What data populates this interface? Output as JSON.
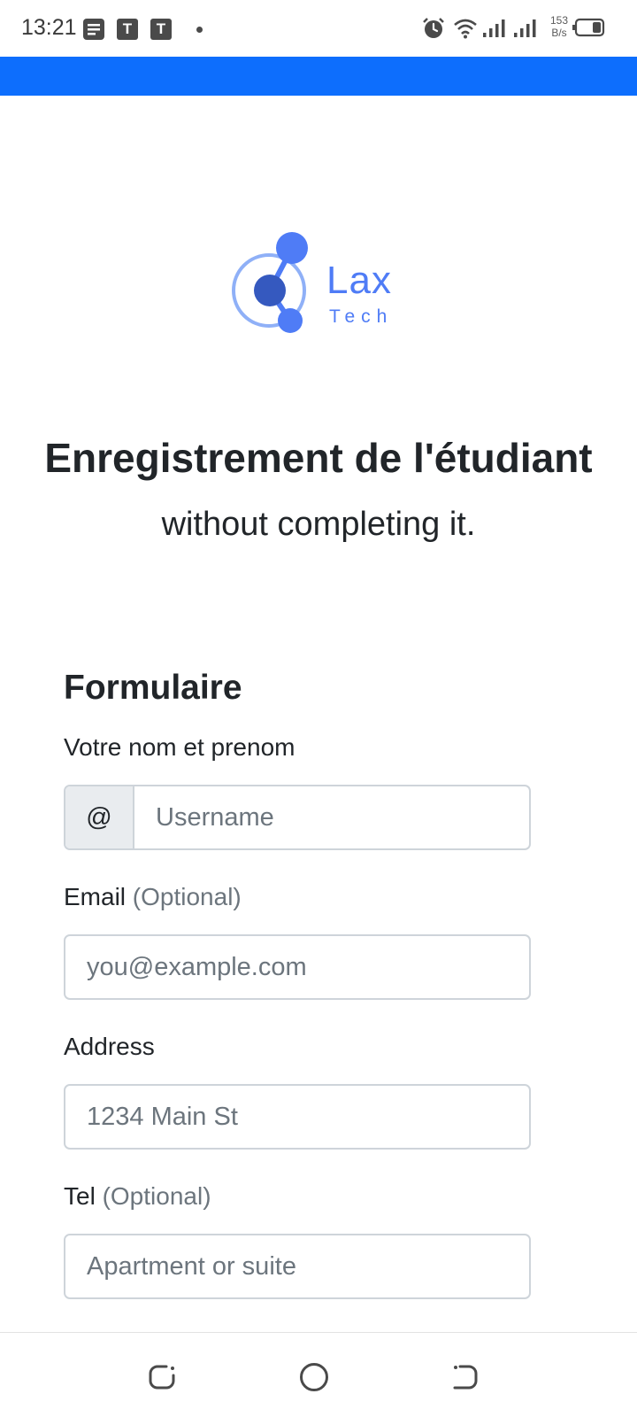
{
  "status_bar": {
    "time": "13:21",
    "notif_icons": [
      "notes-icon",
      "t-app-icon",
      "t-app-icon"
    ],
    "notif_letters": [
      "T",
      "T"
    ],
    "net_speed_value": "153",
    "net_speed_unit": "B/s"
  },
  "brand": {
    "name_line1": "Lax",
    "name_line2": "Tech",
    "color": "#4f7cf6"
  },
  "header": {
    "title": "Enregistrement de l'étudiant",
    "subtitle": "without completing it."
  },
  "form": {
    "heading": "Formulaire",
    "fields": {
      "username": {
        "label": "Votre nom et prenom",
        "addon": "@",
        "placeholder": "Username"
      },
      "email": {
        "label": "Email",
        "optional": "(Optional)",
        "placeholder": "you@example.com"
      },
      "address": {
        "label": "Address",
        "placeholder": "1234 Main St"
      },
      "tel": {
        "label": "Tel",
        "optional": "(Optional)",
        "placeholder": "Apartment or suite"
      }
    }
  },
  "colors": {
    "top_bar": "#0d6efd",
    "text": "#212529",
    "muted": "#6c757d",
    "border": "#ced4da"
  }
}
